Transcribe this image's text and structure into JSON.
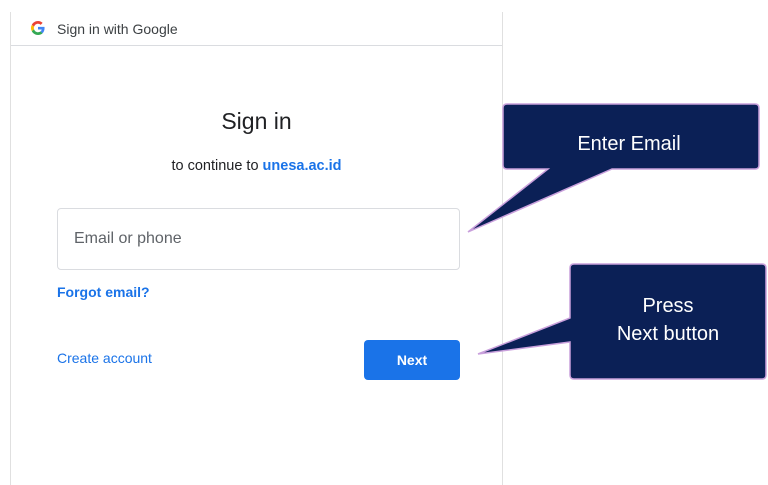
{
  "header": {
    "title": "Sign in with Google",
    "logo_icon": "google-g-icon"
  },
  "main": {
    "title": "Sign in",
    "subtitle_prefix": "to continue to ",
    "subtitle_domain": "unesa.ac.id",
    "email_placeholder": "Email or phone",
    "email_value": "",
    "forgot_email_label": "Forgot email?",
    "create_account_label": "Create account",
    "next_label": "Next"
  },
  "callouts": {
    "enter_email": "Enter Email",
    "press_next_line1": "Press",
    "press_next_line2": "Next button"
  },
  "colors": {
    "accent": "#1a73e8",
    "callout_fill": "#0b2056",
    "callout_border": "#c9a0dc"
  }
}
